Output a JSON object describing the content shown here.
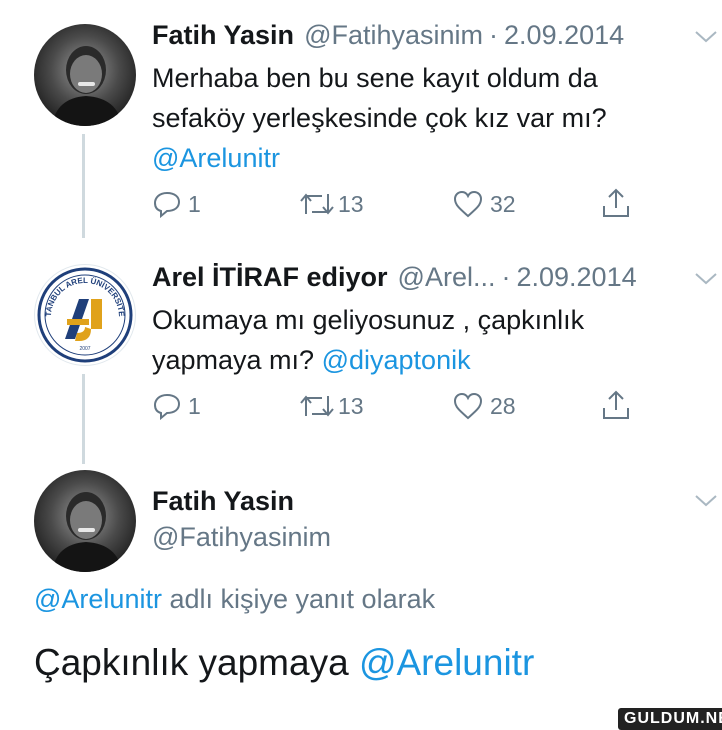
{
  "tweets": [
    {
      "name": "Fatih Yasin",
      "handle": "@Fatihyasinim",
      "separator": "·",
      "date": "2.09.2014",
      "text_line1": "Merhaba ben bu sene kayıt oldum da",
      "text_line2": "sefaköy yerleşkesinde çok kız var mı?",
      "mention": "@Arelunitr",
      "replies": "1",
      "retweets": "13",
      "likes": "32"
    },
    {
      "name": "Arel İTİRAF ediyor",
      "handle": "@Arel...",
      "separator": "·",
      "date": "2.09.2014",
      "text_line1": "Okumaya mı geliyosunuz , çapkınlık",
      "text_line2_prefix": "yapmaya mı?",
      "mention": "@diyaptonik",
      "replies": "1",
      "retweets": "13",
      "likes": "28",
      "logo_text": "İSTANBUL AREL ÜNİVERSİTESİ",
      "logo_year": "2007"
    }
  ],
  "focused_tweet": {
    "name": "Fatih Yasin",
    "handle": "@Fatihyasinim",
    "reply_mention": "@Arelunitr",
    "reply_context": "adlı kişiye yanıt olarak",
    "text": "Çapkınlık yapmaya",
    "text_mention": "@Arelunitr"
  },
  "watermark": "GULDUM.NET",
  "colors": {
    "link": "#1b95e0",
    "secondary_text": "#657786",
    "thread_line": "#cfd9de"
  },
  "icons": [
    "reply-icon",
    "retweet-icon",
    "like-icon",
    "share-icon",
    "chevron-down-icon"
  ]
}
